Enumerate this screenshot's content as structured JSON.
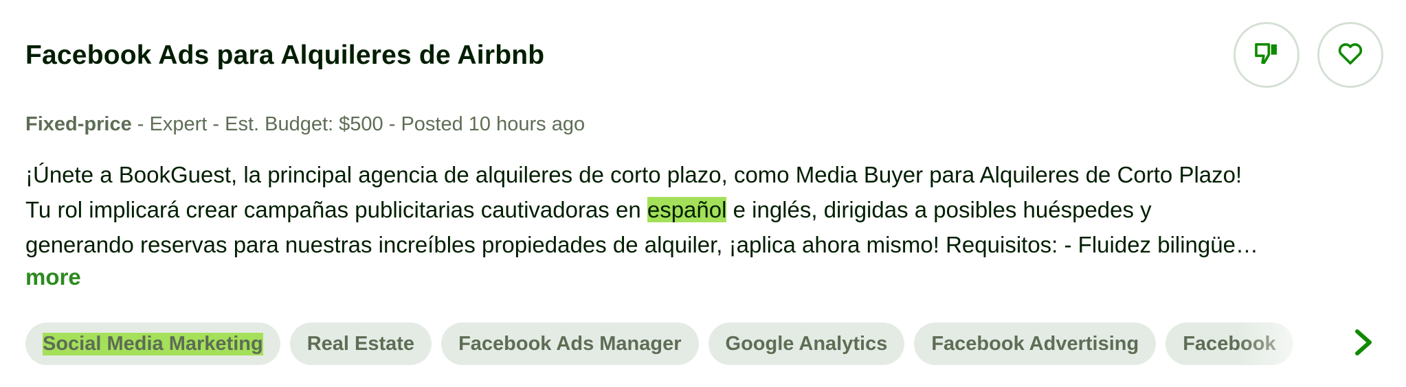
{
  "job": {
    "title": "Facebook Ads para Alquileres de Airbnb",
    "meta": {
      "type": "Fixed-price",
      "sep1": " - ",
      "level": "Expert",
      "sep2": " - ",
      "budget": "Est. Budget: $500",
      "sep3": " - ",
      "posted": "Posted 10 hours ago"
    },
    "description": {
      "line1": "¡Únete a BookGuest, la principal agencia de alquileres de corto plazo, como Media Buyer para Alquileres de Corto Plazo!",
      "line2_before": "Tu rol implicará crear campañas publicitarias cautivadoras en ",
      "line2_highlight": "español",
      "line2_after": " e inglés, dirigidas a posibles huéspedes y",
      "line3": "generando reservas para nuestras increíbles propiedades de alquiler, ¡aplica ahora mismo! Requisitos: - Fluidez bilingüe…"
    },
    "more_label": "more",
    "skills": [
      "Social Media Marketing",
      "Real Estate",
      "Facebook Ads Manager",
      "Google Analytics",
      "Facebook Advertising",
      "Facebook"
    ]
  },
  "icons": {
    "dislike": "thumbs-down-icon",
    "save": "heart-icon",
    "next": "chevron-right-icon"
  },
  "colors": {
    "accent": "#14a800",
    "icon_green": "#108a00",
    "highlight": "#a4e05a",
    "chip_bg": "#e4ebe4",
    "muted_text": "#5e6d55",
    "title_text": "#001e00"
  }
}
